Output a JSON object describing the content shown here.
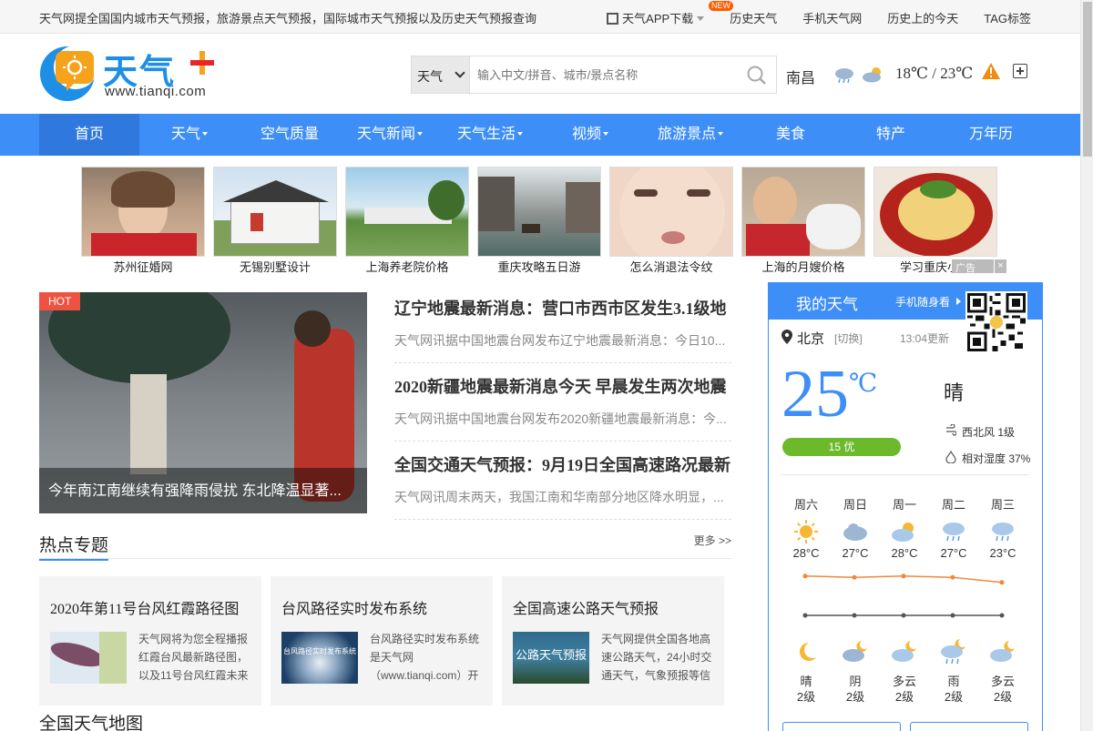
{
  "topbar": {
    "intro": "天气网提全国国内城市天气预报，旅游景点天气预报，国际城市天气预报以及历史天气预报查询",
    "app_label": "天气APP下载",
    "new_badge": "NEW",
    "links": [
      "历史天气",
      "手机天气网",
      "历史上的今天",
      "TAG标签"
    ]
  },
  "logo": {
    "brand": "天气",
    "url": "www.tianqi.com"
  },
  "search": {
    "scope": "天气",
    "placeholder": "输入中文/拼音、城市/景点名称"
  },
  "header_weather": {
    "city": "南昌",
    "temp": "18℃ / 23℃",
    "icons": [
      "rain-cloud-icon",
      "partly-cloudy-icon"
    ]
  },
  "nav": [
    {
      "label": "首页",
      "dropdown": false
    },
    {
      "label": "天气",
      "dropdown": true
    },
    {
      "label": "空气质量",
      "dropdown": false
    },
    {
      "label": "天气新闻",
      "dropdown": true
    },
    {
      "label": "天气生活",
      "dropdown": true
    },
    {
      "label": "视频",
      "dropdown": true
    },
    {
      "label": "旅游景点",
      "dropdown": true
    },
    {
      "label": "美食",
      "dropdown": false
    },
    {
      "label": "特产",
      "dropdown": false
    },
    {
      "label": "万年历",
      "dropdown": false
    }
  ],
  "ads": {
    "items": [
      "苏州征婚网",
      "无锡别墅设计",
      "上海养老院价格",
      "重庆攻略五日游",
      "怎么消退法令纹",
      "上海的月嫂价格",
      "学习重庆小面"
    ],
    "label": "广告"
  },
  "feature": {
    "badge": "HOT",
    "title": "今年南江南继续有强降雨侵扰 东北降温显著..."
  },
  "news": [
    {
      "title": "辽宁地震最新消息：营口市西市区发生3.1级地",
      "summary": "天气网讯据中国地震台网发布辽宁地震最新消息：今日10..."
    },
    {
      "title": "2020新疆地震最新消息今天 早晨发生两次地震",
      "summary": "天气网讯据中国地震台网发布2020新疆地震最新消息：今..."
    },
    {
      "title": "全国交通天气预报：9月19日全国高速路况最新",
      "summary": "天气网讯周末两天，我国江南和华南部分地区降水明显，..."
    }
  ],
  "topics_section": {
    "title": "热点专题",
    "more": "更多 >>"
  },
  "topics": [
    {
      "title": "2020年第11号台风红霞路径图",
      "desc": "天气网将为您全程播报红霞台风最新路径图，以及11号台风红霞未来"
    },
    {
      "title": "台风路径实时发布系统",
      "desc": "台风路径实时发布系统是天气网（www.tianqi.com）开",
      "img_text": "台风路径实时发布系统"
    },
    {
      "title": "全国高速公路天气预报",
      "desc": "天气网提供全国各地高速公路天气，24小时交通天气，气象预报等信",
      "img_text": "公路天气预报"
    }
  ],
  "map_section": {
    "title": "全国天气地图"
  },
  "my_weather": {
    "title": "我的天气",
    "mobile": "手机随身看",
    "city": "北京",
    "switch": "[切换]",
    "updated": "13:04更新",
    "temp": "25",
    "unit": "℃",
    "condition": "晴",
    "aqi": "15 优",
    "wind": "西北风 1级",
    "humidity": "相对湿度 37%",
    "forecast": [
      {
        "day": "周六",
        "high": "28°C",
        "day_icon": "sunny-icon",
        "night_icon": "moon-icon",
        "night_cond": "晴",
        "wind": "2级"
      },
      {
        "day": "周日",
        "high": "27°C",
        "day_icon": "cloudy-icon",
        "night_icon": "cloudy-night-icon",
        "night_cond": "阴",
        "wind": "2级"
      },
      {
        "day": "周一",
        "high": "28°C",
        "day_icon": "partly-cloudy-icon",
        "night_icon": "partly-cloudy-night-icon",
        "night_cond": "多云",
        "wind": "2级"
      },
      {
        "day": "周二",
        "high": "27°C",
        "day_icon": "rain-icon",
        "night_icon": "rain-night-icon",
        "night_cond": "雨",
        "wind": "2级"
      },
      {
        "day": "周三",
        "high": "23°C",
        "day_icon": "rain-icon",
        "night_icon": "partly-cloudy-night-icon",
        "night_cond": "多云",
        "wind": "2级"
      }
    ]
  },
  "chart_data": {
    "type": "line",
    "x": [
      "周六",
      "周日",
      "周一",
      "周二",
      "周三"
    ],
    "series": [
      {
        "values": [
          28,
          27,
          28,
          27,
          23
        ],
        "color": "#f0883a"
      },
      {
        "color": "#555555"
      }
    ],
    "grid": false
  },
  "colors": {
    "accent": "#3e8ef7",
    "hot": "#ee5342",
    "aqi_good": "#6cb92c",
    "high_line": "#f0883a"
  }
}
